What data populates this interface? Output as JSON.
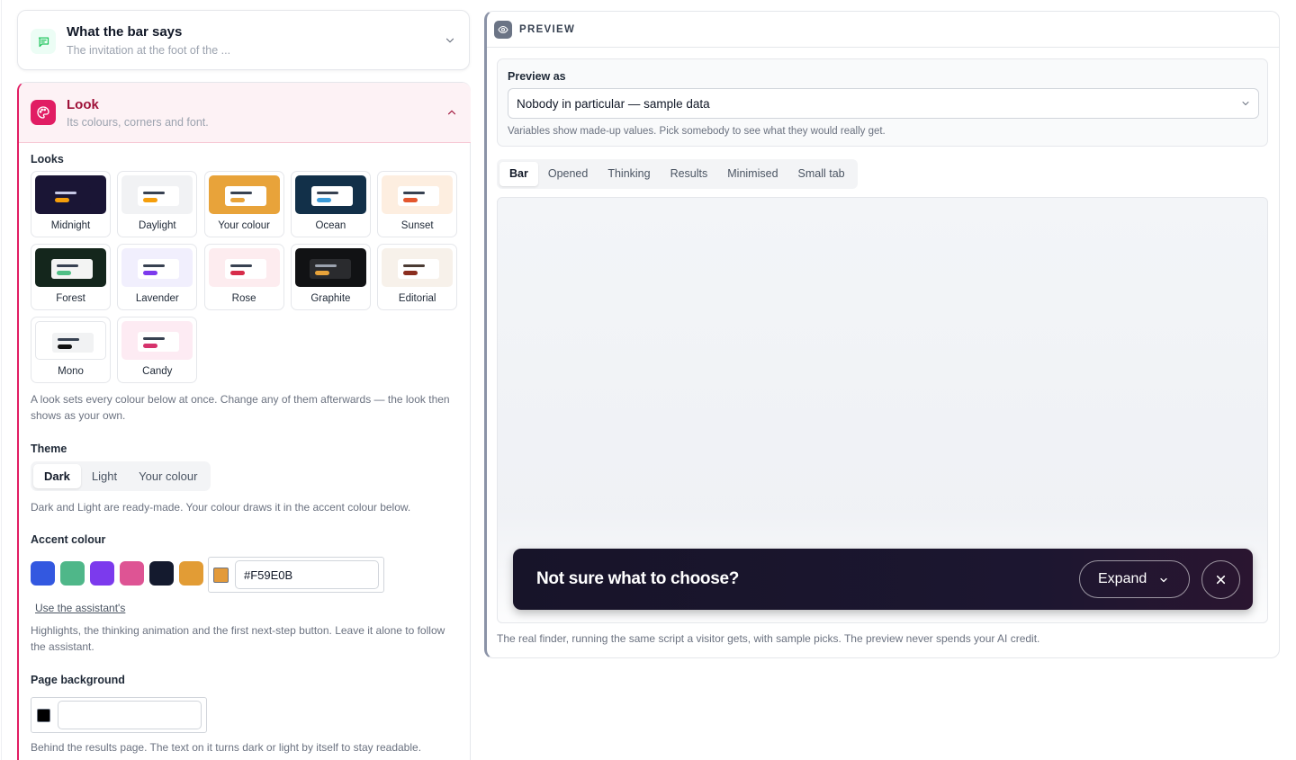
{
  "bar_says": {
    "title": "What the bar says",
    "subtitle": "The invitation at the foot of the ...",
    "icon": "chat-icon"
  },
  "look": {
    "title": "Look",
    "subtitle": "Its colours, corners and font.",
    "icon": "palette-icon",
    "looks_label": "Looks",
    "looks": [
      {
        "name": "Midnight",
        "bg": "#1a1535",
        "inner": "#1a1535",
        "line": "#c7c9e6",
        "pill": "#f59e0b"
      },
      {
        "name": "Daylight",
        "bg": "#f1f2f4",
        "inner": "#ffffff",
        "line": "#374151",
        "pill": "#f59e0b"
      },
      {
        "name": "Your colour",
        "bg": "#e8a33a",
        "inner": "#ffffff",
        "line": "#374151",
        "pill": "#e8a33a"
      },
      {
        "name": "Ocean",
        "bg": "#123049",
        "inner": "#ffffff",
        "line": "#374151",
        "pill": "#3b9bd9"
      },
      {
        "name": "Sunset",
        "bg": "#fdeee0",
        "inner": "#ffffff",
        "line": "#374151",
        "pill": "#e4572e"
      },
      {
        "name": "Forest",
        "bg": "#14261c",
        "inner": "#f3f4f3",
        "line": "#374151",
        "pill": "#4fbf85"
      },
      {
        "name": "Lavender",
        "bg": "#f1effd",
        "inner": "#ffffff",
        "line": "#374151",
        "pill": "#7c3aed"
      },
      {
        "name": "Rose",
        "bg": "#fdecef",
        "inner": "#ffffff",
        "line": "#374151",
        "pill": "#d72c4a"
      },
      {
        "name": "Graphite",
        "bg": "#111214",
        "inner": "#2a2b2e",
        "line": "#9ca3af",
        "pill": "#e8a33a"
      },
      {
        "name": "Editorial",
        "bg": "#f7f1ea",
        "inner": "#ffffff",
        "line": "#4b3b33",
        "pill": "#8b2e1f"
      },
      {
        "name": "Mono",
        "bg": "#ffffff",
        "inner": "#f1f2f3",
        "line": "#374151",
        "pill": "#111111"
      },
      {
        "name": "Candy",
        "bg": "#fdebf3",
        "inner": "#ffffff",
        "line": "#374151",
        "pill": "#d6336c"
      }
    ],
    "looks_help": "A look sets every colour below at once. Change any of them afterwards — the look then shows as your own.",
    "theme_label": "Theme",
    "theme_options": [
      "Dark",
      "Light",
      "Your colour"
    ],
    "theme_selected": "Dark",
    "theme_help": "Dark and Light are ready-made. Your colour draws it in the accent colour below.",
    "accent_label": "Accent colour",
    "accent_swatches": [
      "#3358e0",
      "#4fb789",
      "#7c3aed",
      "#de5494",
      "#141a2e",
      "#e29c35"
    ],
    "accent_chip_color": "#E39A3A",
    "accent_value": "#F59E0B",
    "accent_link": "Use the assistant's",
    "accent_help": "Highlights, the thinking animation and the first next-step button. Leave it alone to follow the assistant.",
    "page_bg_label": "Page background",
    "page_bg_chip_color": "#000000",
    "page_bg_value": "",
    "page_bg_help": "Behind the results page. The text on it turns dark or light by itself to stay readable."
  },
  "preview": {
    "title": "PREVIEW",
    "icon": "eye-icon",
    "preview_as_label": "Preview as",
    "preview_as_value": "Nobody in particular — sample data",
    "preview_as_help": "Variables show made-up values. Pick somebody to see what they would really get.",
    "tabs": [
      "Bar",
      "Opened",
      "Thinking",
      "Results",
      "Minimised",
      "Small tab"
    ],
    "active_tab": "Bar",
    "bar_text": "Not sure what to choose?",
    "expand_label": "Expand",
    "footer_help": "The real finder, running the same script a visitor gets, with sample picks. The preview never spends your AI credit."
  }
}
